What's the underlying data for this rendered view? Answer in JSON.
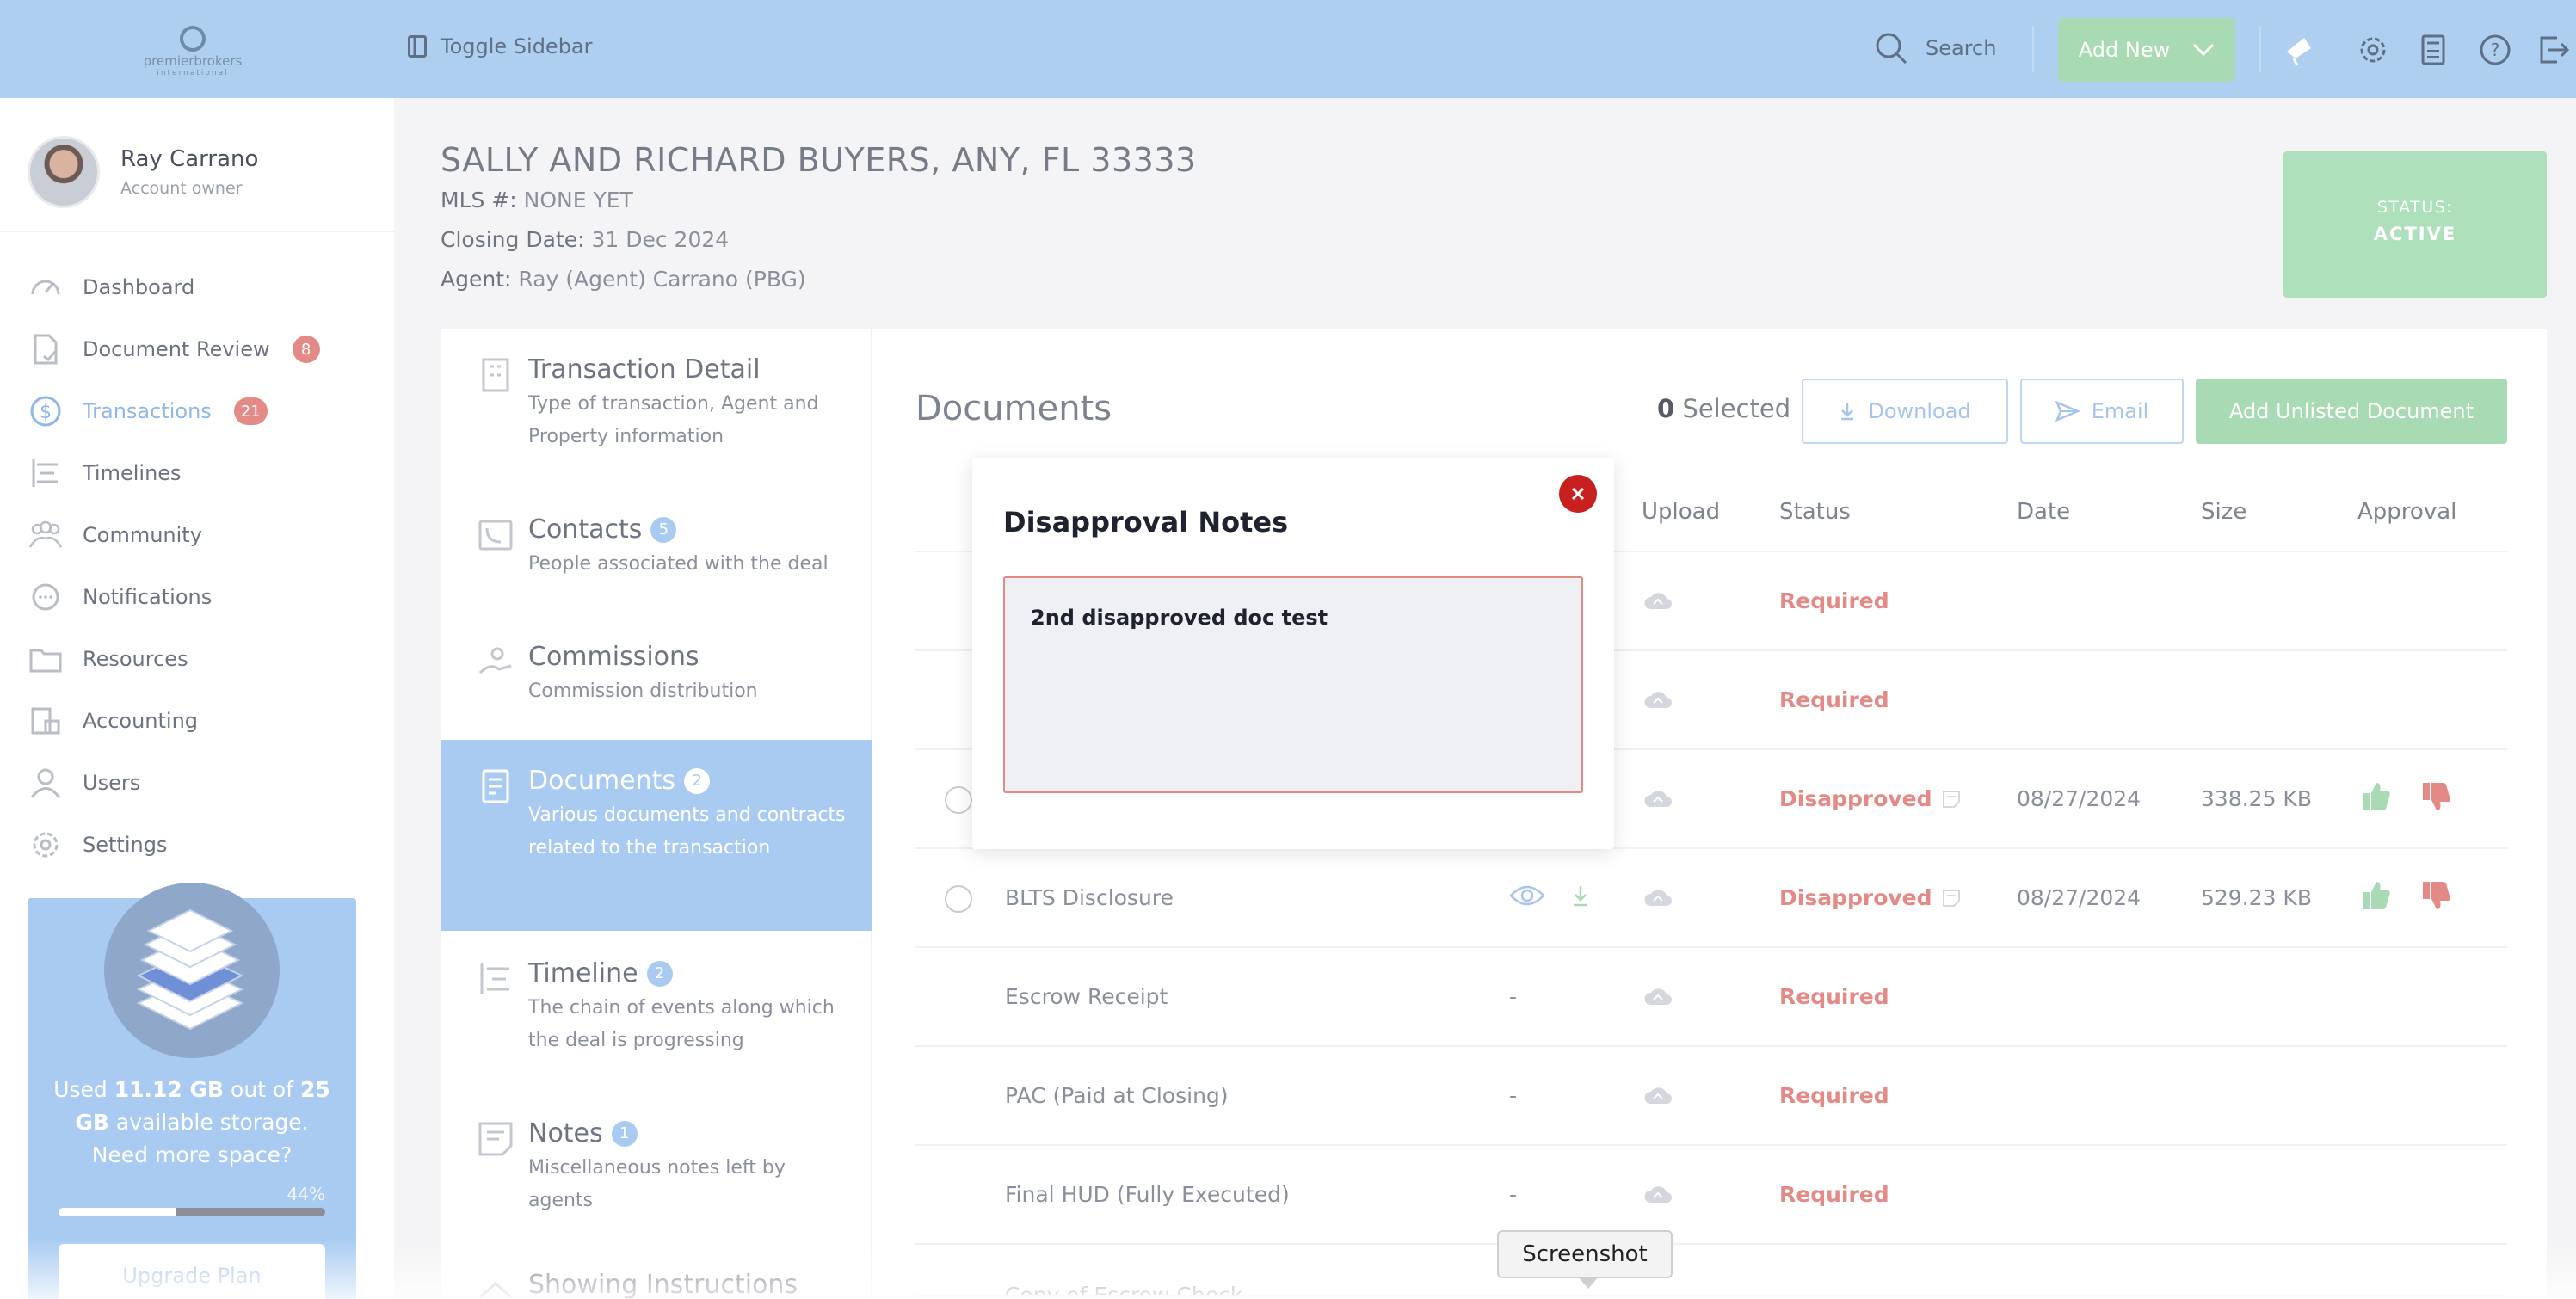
{
  "topbar": {
    "logo_text": "premierbrokers",
    "logo_text_accent": "brokers",
    "logo_sub": "international",
    "toggle_label": "Toggle Sidebar",
    "search_label": "Search",
    "add_new_label": "Add New"
  },
  "profile": {
    "name": "Ray Carrano",
    "role": "Account owner"
  },
  "nav": [
    {
      "label": "Dashboard",
      "icon": "dashboard-icon"
    },
    {
      "label": "Document Review",
      "badge": "8",
      "icon": "document-check-icon"
    },
    {
      "label": "Transactions",
      "badge": "21",
      "icon": "dollar-icon",
      "active": true
    },
    {
      "label": "Timelines",
      "icon": "timeline-icon"
    },
    {
      "label": "Community",
      "icon": "community-icon"
    },
    {
      "label": "Notifications",
      "icon": "chat-bubble-icon"
    },
    {
      "label": "Resources",
      "icon": "folder-icon"
    },
    {
      "label": "Accounting",
      "icon": "accounting-icon"
    },
    {
      "label": "Users",
      "icon": "user-icon"
    },
    {
      "label": "Settings",
      "icon": "gear-icon"
    }
  ],
  "storage": {
    "line1_a": "Used ",
    "used": "11.12 GB",
    "line1_b": " out of ",
    "total": "25 GB",
    "line2": " available storage. Need more space?",
    "percent_label": "44%",
    "percent": 0.44,
    "upgrade_label": "Upgrade Plan"
  },
  "header": {
    "title": "SALLY AND RICHARD BUYERS, ANY, FL 33333",
    "mls_label": "MLS #:",
    "mls_value": "NONE YET",
    "closing_label": "Closing Date:",
    "closing_value": "31 Dec 2024",
    "agent_label": "Agent:",
    "agent_value": "Ray (Agent) Carrano (PBG)",
    "status_label": "STATUS:",
    "status_value": "ACTIVE"
  },
  "tabs": [
    {
      "title": "Transaction Detail",
      "sub": "Type of transaction, Agent and Property information"
    },
    {
      "title": "Contacts",
      "badge": "5",
      "sub": "People associated with the deal"
    },
    {
      "title": "Commissions",
      "sub": "Commission distribution"
    },
    {
      "title": "Documents",
      "badge": "2",
      "sub": "Various documents and contracts related to the transaction",
      "active": true
    },
    {
      "title": "Timeline",
      "badge": "2",
      "sub": "The chain of events along which the deal is progressing"
    },
    {
      "title": "Notes",
      "badge": "1",
      "sub": "Miscellaneous notes left by agents"
    },
    {
      "title": "Showing Instructions",
      "sub": ""
    }
  ],
  "documents": {
    "title": "Documents",
    "selected_count": "0",
    "selected_label": " Selected",
    "download_label": "Download",
    "email_label": "Email",
    "add_unlisted_label": "Add Unlisted Document",
    "columns": {
      "upload": "Upload",
      "status": "Status",
      "date": "Date",
      "size": "Size",
      "approval": "Approval"
    },
    "rows": [
      {
        "name": "",
        "file": "",
        "status": "Required",
        "date": "",
        "size": ""
      },
      {
        "name": "",
        "file": "",
        "status": "Required",
        "date": "",
        "size": ""
      },
      {
        "name": "",
        "file": "",
        "status": "Disapproved",
        "date": "08/27/2024",
        "size": "338.25 KB"
      },
      {
        "name": "BLTS Disclosure",
        "file": "view",
        "status": "Disapproved",
        "date": "08/27/2024",
        "size": "529.23 KB"
      },
      {
        "name": "Escrow Receipt",
        "file": "-",
        "status": "Required",
        "date": "",
        "size": ""
      },
      {
        "name": "PAC (Paid at Closing)",
        "file": "-",
        "status": "Required",
        "date": "",
        "size": ""
      },
      {
        "name": "Final HUD (Fully Executed)",
        "file": "-",
        "status": "Required",
        "date": "",
        "size": ""
      },
      {
        "name": "Copy of Escrow Check",
        "file": "-",
        "status": "",
        "date": "",
        "size": ""
      }
    ]
  },
  "modal": {
    "title": "Disapproval Notes",
    "note": "2nd disapproved doc test"
  },
  "tooltip": {
    "label": "Screenshot"
  },
  "colors": {
    "primary": "#a9cbf2",
    "success": "#a8dbb4",
    "danger": "#e38a86",
    "close": "#c8201e"
  }
}
